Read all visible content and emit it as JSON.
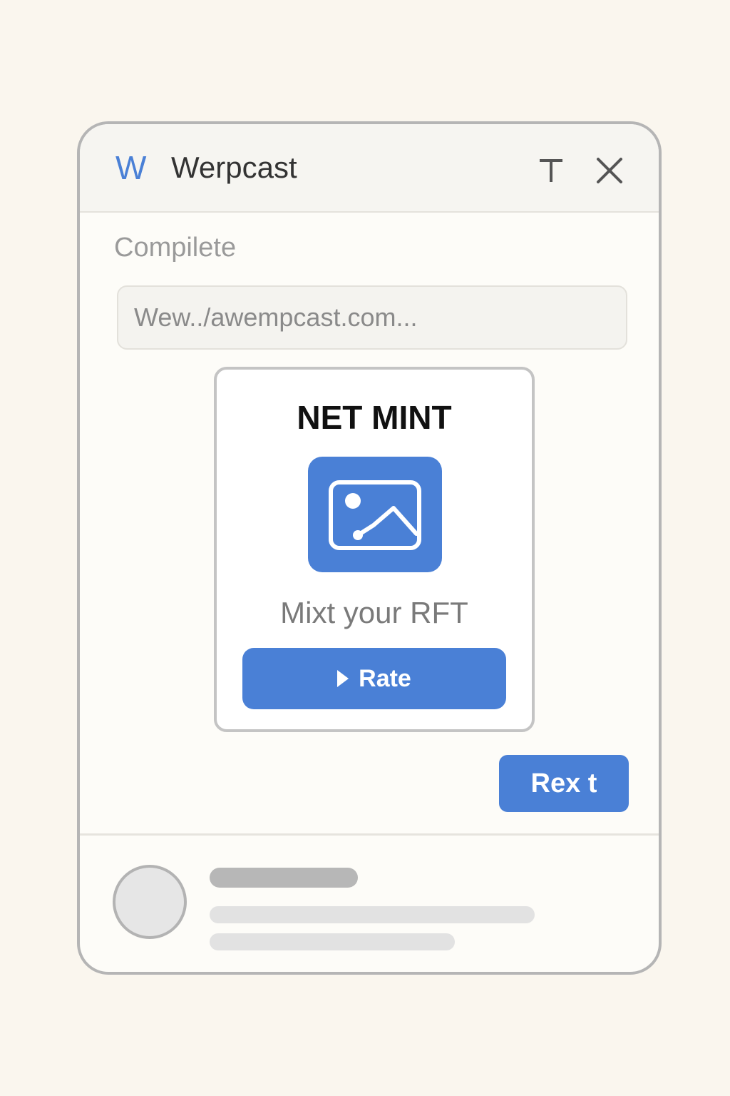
{
  "window": {
    "app_name": "Werpcast",
    "logo_letter": "W",
    "text_tool_icon": "text-tool-icon",
    "close_icon": "close-icon"
  },
  "main": {
    "section_label": "Compilete",
    "url_input": {
      "placeholder": "Wew../awempcast.com..."
    }
  },
  "card": {
    "title": "NET MINT",
    "image_icon": "image-placeholder-icon",
    "subtitle": "Mixt your RFT",
    "action_label": "Rate",
    "action_icon": "play-icon"
  },
  "footer_actions": {
    "next_label": "Rex t"
  },
  "colors": {
    "accent": "#4a80d6",
    "background": "#faf6ee",
    "window_border": "#b5b5b5",
    "title_text": "#333333",
    "muted_text": "#9a9a9a"
  }
}
